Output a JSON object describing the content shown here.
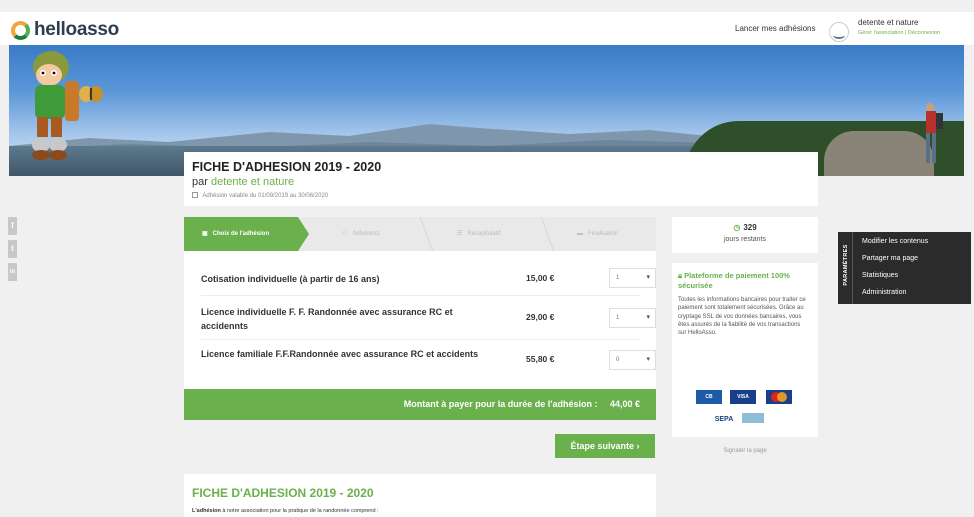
{
  "header": {
    "logo": "helloasso",
    "launch_label": "Lancer mes adhésions",
    "user_name": "detente et nature",
    "manage_link": "Gérer l'association",
    "link_separator": "|",
    "logout_link": "Déconnexion"
  },
  "form": {
    "title": "FICHE D'ADHESION 2019 - 2020",
    "by_prefix": "par",
    "association": "detente et nature",
    "validity": "Adhésion valable du 01/09/2019 au 30/06/2020"
  },
  "social": [
    "f",
    "t",
    "in"
  ],
  "steps": [
    {
      "label": "Choix de l'adhésion",
      "icon": "cart-icon",
      "active": true
    },
    {
      "label": "Adhérents",
      "icon": "users-icon",
      "active": false
    },
    {
      "label": "Récapitulatif",
      "icon": "list-icon",
      "active": false
    },
    {
      "label": "Finalisation",
      "icon": "card-icon",
      "active": false
    }
  ],
  "items": [
    {
      "name": "Cotisation individuelle (à partir de 16 ans)",
      "price": "15,00 €",
      "quantity": "1"
    },
    {
      "name": "Licence individuelle F. F. Randonnée avec assurance RC et accidennts",
      "price": "29,00 €",
      "quantity": "1"
    },
    {
      "name": "Licence familiale F.F.Randonnée avec assurance RC et accidents",
      "price": "55,80 €",
      "quantity": "0"
    }
  ],
  "total": {
    "label": "Montant à payer pour la durée de l'adhésion :",
    "amount": "44,00 €"
  },
  "next_button": "Étape suivante ›",
  "bottom": {
    "title": "FICHE D'ADHESION 2019 - 2020",
    "intro_bold": "L'adhésion",
    "intro_rest": " à notre association pour la pratique de la randonnée comprend :"
  },
  "countdown": {
    "days": "329",
    "label": "jours restants"
  },
  "security": {
    "title": "Plateforme de paiement 100% sécurisée",
    "description": "Toutes les informations bancaires pour traiter ce paiement sont totalement sécurisées. Grâce au cryptage SSL de vos données bancaires, vous êtes assurés de la fiabilité de vos transactions sur HelloAsso.",
    "card_logos": [
      "CB",
      "VISA",
      "",
      "SEPA",
      ""
    ]
  },
  "report_link": "Signaler la page",
  "settings": {
    "label": "PARAMÈTRES",
    "links": [
      "Modifier les contenus",
      "Partager ma page",
      "Statistiques",
      "Administration"
    ]
  },
  "colors": {
    "accent": "#6ab04c",
    "dark_panel": "#2b2b2b",
    "background": "#f0f0f0"
  }
}
